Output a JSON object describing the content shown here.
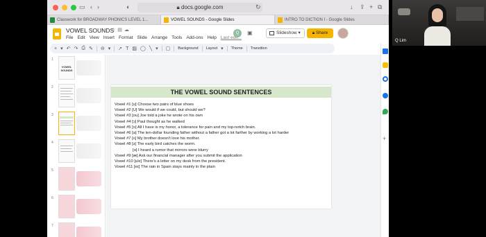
{
  "browser": {
    "url": "docs.google.com",
    "tabs": [
      {
        "label": "Classwork for BROADWAY PHONICS LEVEL 1...",
        "color": "#1e8e3e",
        "active": false
      },
      {
        "label": "VOWEL SOUNDS - Google Slides",
        "color": "#f4b400",
        "active": true
      },
      {
        "label": "INTRO TO DICTION I - Google Slides",
        "color": "#f4b400",
        "active": false
      }
    ]
  },
  "slides_app": {
    "doc_title": "VOWEL SOUNDS",
    "menus": [
      "File",
      "Edit",
      "View",
      "Insert",
      "Format",
      "Slide",
      "Arrange",
      "Tools",
      "Add-ons",
      "Help"
    ],
    "last_edit": "Last edit...",
    "collaborator_initial": "Q",
    "slideshow_label": "Slideshow",
    "share_label": "Share"
  },
  "toolbar": {
    "zoom_symbol": "⊖",
    "background_label": "Background",
    "layout_label": "Layout",
    "theme_label": "Theme",
    "transition_label": "Transition"
  },
  "filmstrip": {
    "slides": [
      {
        "number": "1",
        "text": "VOWEL SOUNDS"
      },
      {
        "number": "2",
        "text": ""
      },
      {
        "number": "3",
        "text": ""
      },
      {
        "number": "4",
        "text": ""
      },
      {
        "number": "5",
        "text": ""
      },
      {
        "number": "6",
        "text": ""
      },
      {
        "number": "7",
        "text": ""
      }
    ]
  },
  "slide": {
    "title": "THE VOWEL SOUND SENTENCES",
    "lines": [
      {
        "text": "Vowel #1  [u] Choose two pairs of blue shoes",
        "indent": false
      },
      {
        "text": "Vowel #2  [U] We would if we could, but should we?",
        "indent": false
      },
      {
        "text": "Vowel #3 [ou] Joe told a joke he wrote on his own",
        "indent": false
      },
      {
        "text": "Vowel #4 [ɔ] Paul thought as he walked",
        "indent": false
      },
      {
        "text": "Vowel #5 [o] All I have is my honor, a tolerance for pain and my top-notch brain.",
        "indent": false
      },
      {
        "text": "Vowel #6 [a]  The ten-dollar founding father without a father got a lot farther by working a lot harder",
        "indent": false
      },
      {
        "text": "Vowel #7 [ʌ] My brother doesn't love his mother.",
        "indent": false
      },
      {
        "text": "Vowel #8 [ɜ] The early bird catches the worm.",
        "indent": false
      },
      {
        "text": "[ə] I heard a rumor that mirrors were blurry",
        "indent": true
      },
      {
        "text": "Vowel #9 [æ] Ask our financial manager after you submit the application",
        "indent": false
      },
      {
        "text": "Vowel #10 [ɛ/e] There's a letter on my desk from the president.",
        "indent": false
      },
      {
        "text": "Vowel #11 [eɪ] The rain in Spain stays mainly in the plain",
        "indent": false
      }
    ]
  },
  "camera": {
    "participant_name": "Q Lim"
  },
  "colors": {
    "slides_yellow": "#f4b400",
    "title_band_green": "#d6e7cc"
  }
}
